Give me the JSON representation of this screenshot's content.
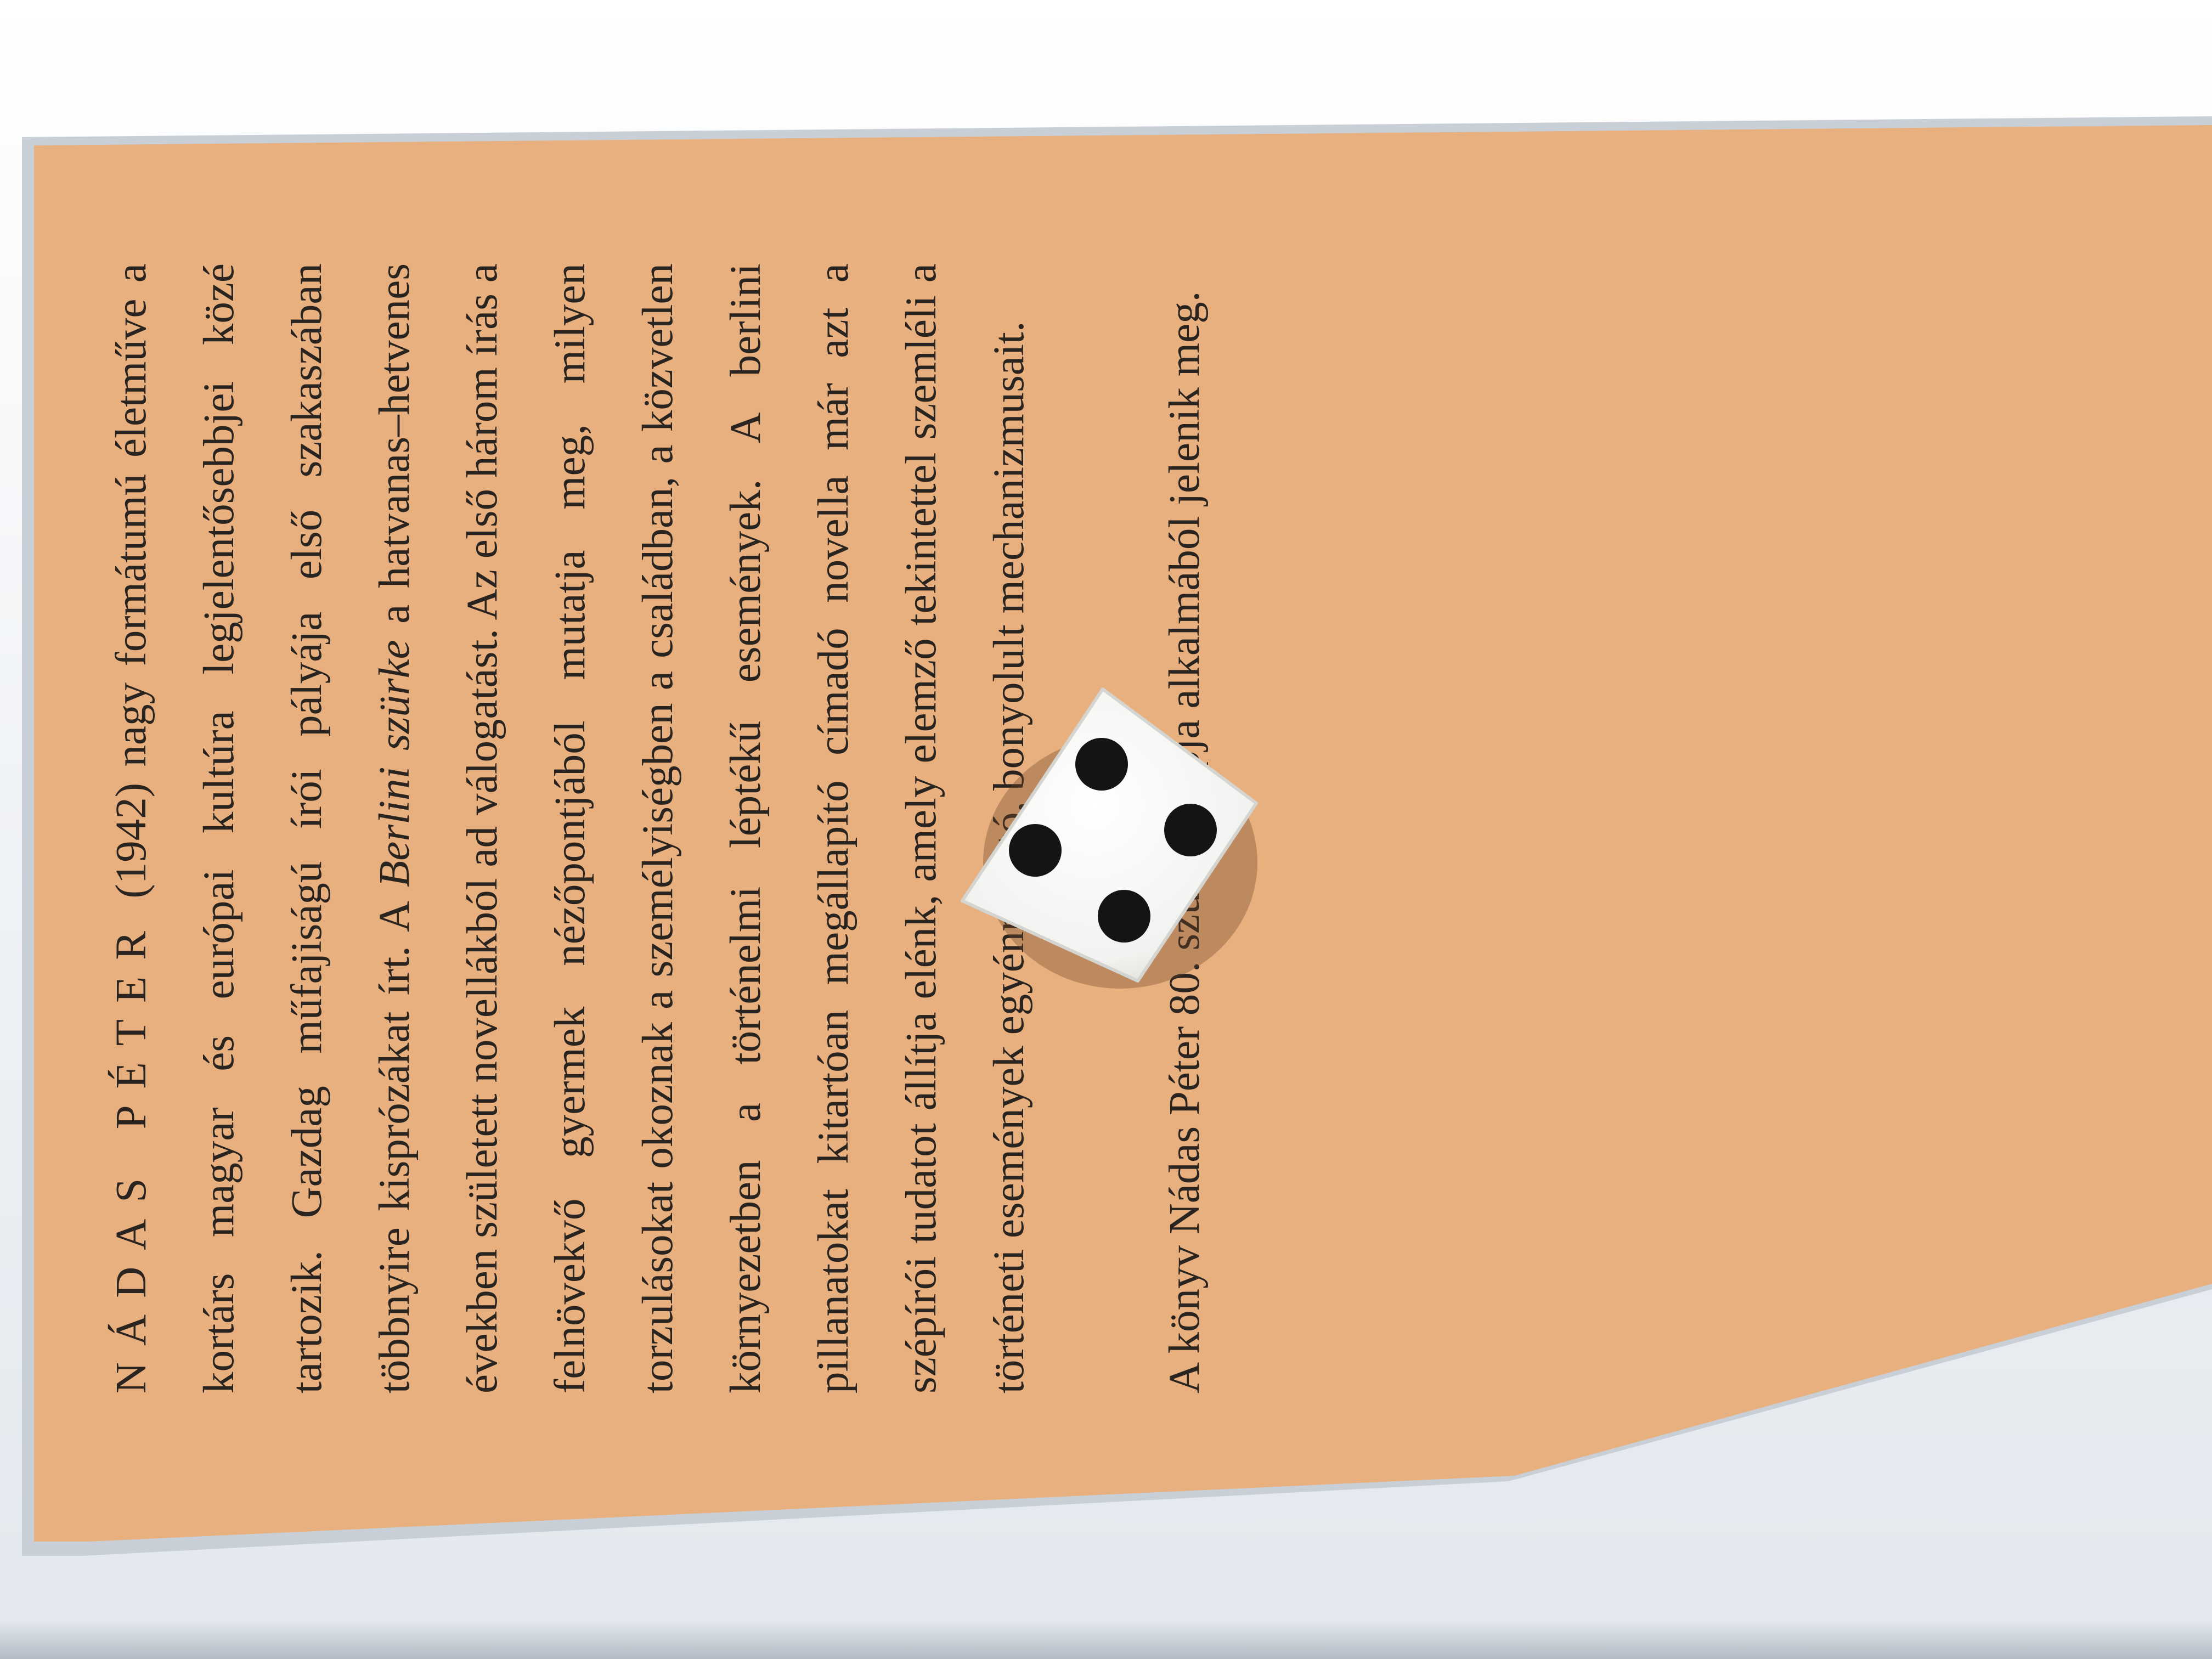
{
  "book_blurb": {
    "lead": "NÁDAS PÉTER",
    "p1_a": " (1942) nagy formátumú életműve a kortárs magyar és európai kultúra legjelentősebbjei közé tartozik. Gazdag műfajiságú írói pályája első szakaszában többnyire kisprózákat írt. A ",
    "p1_italic": "Berlini szürke",
    "p1_b": " a hatvanas–hetvenes években született novellákból ad válogatást. Az első három írás a felnövekvő gyermek nézőpontjából mutatja meg, milyen torzulásokat okoznak a személyiségben a családban, a közvetlen környezetben a történelmi léptékű események. A berlini pillanatokat kitartóan megállapító címadó novella már azt a szépírói tudatot állítja elénk, amely elemző tekintettel szemléli a történeti események egyénre ható, bonyolult mechanizmusait.",
    "p2": "A könyv Nádas Péter 80. születésnapja alkalmából jelenik meg."
  },
  "colors": {
    "panel": "#e8b07e",
    "cover": "#eef1f5",
    "text": "#2a2420",
    "die": "#f6f6f4",
    "pip": "#141414"
  },
  "die": {
    "face_value": 4
  }
}
